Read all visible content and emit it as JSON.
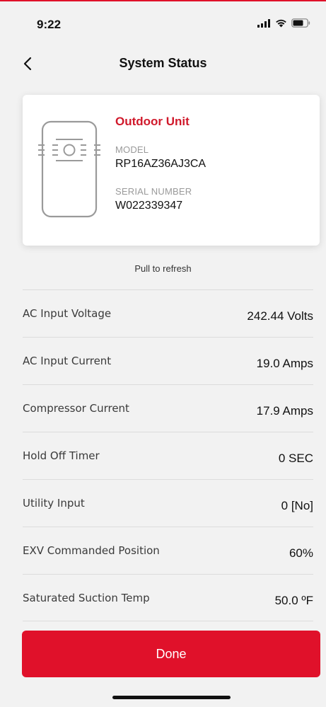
{
  "status_bar": {
    "time": "9:22"
  },
  "nav": {
    "title": "System Status"
  },
  "unit_card": {
    "title": "Outdoor Unit",
    "model_label": "MODEL",
    "model_value": "RP16AZ36AJ3CA",
    "serial_label": "SERIAL NUMBER",
    "serial_value": "W022339347"
  },
  "refresh_hint": "Pull to refresh",
  "status_rows": [
    {
      "label": "AC Input Voltage",
      "value": "242.44 Volts"
    },
    {
      "label": "AC Input Current",
      "value": "19.0 Amps"
    },
    {
      "label": "Compressor Current",
      "value": "17.9 Amps"
    },
    {
      "label": "Hold Off Timer",
      "value": "0 SEC"
    },
    {
      "label": "Utility Input",
      "value": "0 [No]"
    },
    {
      "label": "EXV Commanded Position",
      "value": "60%"
    },
    {
      "label": "Saturated Suction Temp",
      "value": "50.0 ºF"
    }
  ],
  "done_button": {
    "label": "Done"
  },
  "colors": {
    "accent": "#e0112a",
    "title_red": "#d0192b",
    "background": "#f2f2f2"
  },
  "icons": [
    "signal-icon",
    "wifi-icon",
    "battery-icon",
    "back-chevron-icon",
    "outdoor-unit-icon"
  ]
}
